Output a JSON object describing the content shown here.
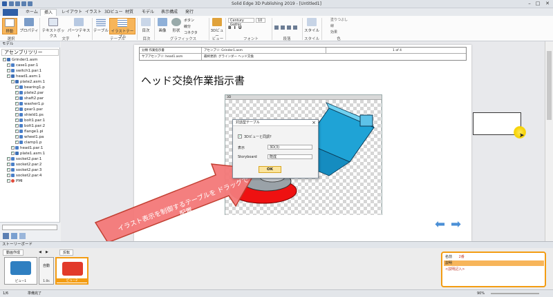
{
  "app": {
    "title": "Solid Edge 3D Publishing 2019 - [Untitled1]"
  },
  "tabs": [
    "ホーム",
    "挿入",
    "レイアウト",
    "イラスト",
    "3Dビュー",
    "材質",
    "モデル",
    "表示構成",
    "発行"
  ],
  "active_tab": "挿入",
  "ribbon": {
    "buttons": [
      {
        "label": "選択",
        "sub": "移動"
      },
      {
        "label": "プロパティ"
      },
      {
        "label": "テキストボックス"
      },
      {
        "label": "パーツテキスト"
      },
      {
        "label": "テーブル"
      },
      {
        "label": "イラストテーブル"
      },
      {
        "label": "目次"
      },
      {
        "label": "画像"
      },
      {
        "label": "形状"
      },
      {
        "label": "3Dビュー"
      }
    ],
    "small_items": [
      "ボタン",
      "線分",
      "コネクタ",
      "文字",
      "スタイル"
    ],
    "font_name": "Century Gothic",
    "font_size": "10",
    "groups": [
      "選択",
      "文字",
      "テーブル",
      "目次",
      "グラフィックス",
      "ビュー",
      "フォント",
      "段落",
      "スタイル",
      "色"
    ],
    "right_items": [
      "塗りつぶし",
      "線",
      "効果"
    ]
  },
  "left_pane": {
    "header": "モデル",
    "tree_title": "アセンブリツリー",
    "items": [
      "Grinder1.asm",
      "case1.par:1",
      "switch1.par:1",
      "head1.asm:1",
      "plate2.asm:1",
      "bearing1.p",
      "plate2.par",
      "shaft2.par",
      "washer1.p",
      "gear1.par",
      "shield1.ps",
      "bolt1.par:1",
      "bolt1.par:2",
      "flange1.pi",
      "wheel1.pa",
      "clamp1.p",
      "head1.par:1",
      "plate1.asm:1",
      "socket2.par:1",
      "socket2.par:2",
      "socket2.par:3",
      "socket2.par:4",
      "PMI"
    ]
  },
  "document": {
    "header_row1": [
      "分類 作業指示書",
      "アセンブリ: Grinder1.asm",
      "1 of 4"
    ],
    "header_row2": [
      "サブアセンブリ: head1.asm",
      "最終更新: グラインダー ヘッド交換"
    ],
    "title": "ヘッド交換作業指示書",
    "image_bar": "3D"
  },
  "dialog": {
    "title": "対話型テーブル",
    "checkbox_label": "3Dビューと同調?",
    "display_label": "表示",
    "display_value": "3D(3)",
    "storyboard_label": "Storyboard",
    "storyboard_value": "既成",
    "ok_label": "OK"
  },
  "callout": {
    "text": "イラスト表示を制御するテーブルを ドラッグで配置"
  },
  "storyboard": {
    "header": "ストーリーボード",
    "buttons": [
      "動画作成",
      "反転"
    ],
    "auto_label": "自動",
    "frames": [
      {
        "label": "ビュー1",
        "time": "1.0s"
      },
      {
        "label": "1.0s",
        "time": ""
      },
      {
        "label": "ビュー2",
        "time": "1.0s"
      }
    ],
    "properties": {
      "name_label": "名前",
      "name_value": "2番",
      "desc_label": "説明",
      "desc_value": "<説明記入>"
    }
  },
  "statusbar": {
    "page": "1/6",
    "status": "準備完了",
    "zoom": "90%"
  }
}
